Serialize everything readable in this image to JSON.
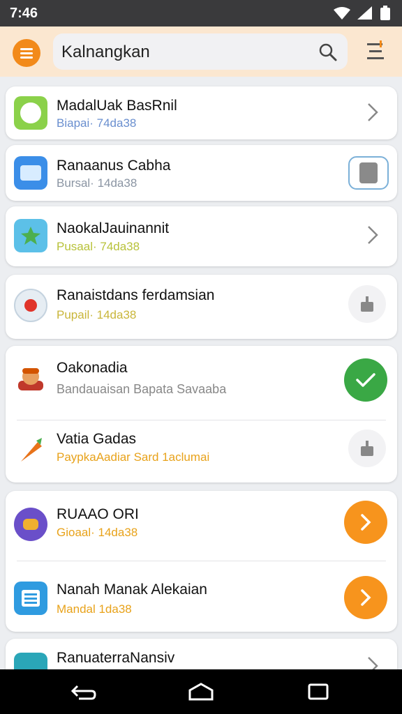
{
  "status": {
    "time": "7:46"
  },
  "search": {
    "value": "Kalnangkan"
  },
  "items": [
    {
      "title": "MadalUak BasRnil",
      "subtitle": "Biapai· 74da38",
      "sub_color": "#6a8fcf",
      "icon": "app-green-circle-icon",
      "action": "chevron-right-icon"
    },
    {
      "title": "Ranaanus Cabha",
      "subtitle": "Bursal· 14da38",
      "sub_color": "#8b95a3",
      "icon": "app-blue-chat-icon",
      "action": "device-button-icon"
    },
    {
      "title": "NaokalJauinannit",
      "subtitle": "Pusaal· 74da38",
      "sub_color": "#b8c23a",
      "icon": "app-leaf-icon",
      "action": "chevron-right-icon"
    },
    {
      "title": "Ranaistdans ferdamsian",
      "subtitle": "Pupail· 14da38",
      "sub_color": "#c9b63a",
      "icon": "app-red-dot-icon",
      "action": "download-icon"
    },
    {
      "title": "Oakonadia",
      "subtitle": "Bandauaisan Bapata Savaaba",
      "sub_color": "#888888",
      "icon": "app-character-icon",
      "action": "check-icon"
    },
    {
      "title": "Vatia Gadas",
      "subtitle": "PaypkaAadiar Sard 1aclumai",
      "sub_color": "#e8a21a",
      "icon": "app-carrot-icon",
      "action": "download-icon"
    },
    {
      "title": "RUAAO ORI",
      "subtitle": "Gioaal· 14da38",
      "sub_color": "#e8a21a",
      "icon": "app-purple-game-icon",
      "action": "arrow-right-icon"
    },
    {
      "title": "Nanah Manak Alekaian",
      "subtitle": "Mandal 1da38",
      "sub_color": "#e8a21a",
      "icon": "app-blue-list-icon",
      "action": "arrow-right-icon"
    },
    {
      "title": "RanuaterraNansiv",
      "subtitle": "",
      "sub_color": "#888888",
      "icon": "app-teal-icon",
      "action": "chevron-right-icon"
    }
  ],
  "colors": {
    "accent": "#f28a1a",
    "success": "#3aa845",
    "app_bar": "#fbe7d0"
  }
}
